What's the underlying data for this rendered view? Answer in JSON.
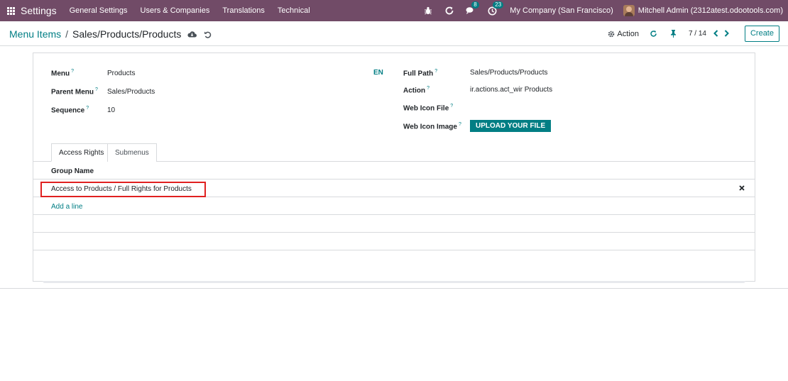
{
  "navbar": {
    "brand": "Settings",
    "menus": [
      "General Settings",
      "Users & Companies",
      "Translations",
      "Technical"
    ],
    "messages_count": "8",
    "activities_count": "23",
    "company": "My Company (San Francisco)",
    "user": "Mitchell Admin (2312atest.odootools.com)"
  },
  "control": {
    "breadcrumb_parent": "Menu Items",
    "breadcrumb_sep": "/",
    "breadcrumb_current": "Sales/Products/Products",
    "action_label": "Action",
    "pager": "7 / 14",
    "create_label": "Create"
  },
  "form": {
    "menu_label": "Menu",
    "menu_value": "Products",
    "lang": "EN",
    "parent_menu_label": "Parent Menu",
    "parent_menu_value": "Sales/Products",
    "sequence_label": "Sequence",
    "sequence_value": "10",
    "full_path_label": "Full Path",
    "full_path_value": "Sales/Products/Products",
    "action_label": "Action",
    "action_value": "ir.actions.act_wir Products",
    "web_icon_file_label": "Web Icon File",
    "web_icon_image_label": "Web Icon Image",
    "upload_label": "UPLOAD YOUR FILE",
    "help_mark": "?"
  },
  "tabs": [
    "Access Rights",
    "Submenus"
  ],
  "access_rights": {
    "column_header": "Group Name",
    "rows": [
      "Access to Products / Full Rights for Products"
    ],
    "add_line": "Add a line"
  },
  "colors": {
    "navbar": "#714b67",
    "accent": "#017e84",
    "highlight": "#e02020"
  }
}
